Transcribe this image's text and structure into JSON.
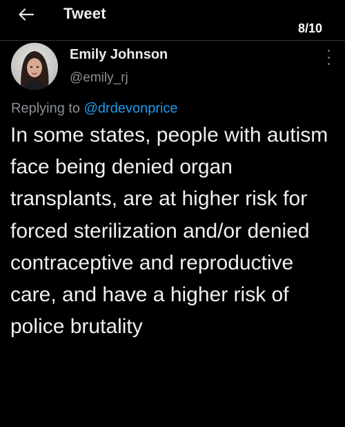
{
  "header": {
    "back_icon": "arrow-left-icon",
    "title": "Tweet",
    "thread_count": "8/10"
  },
  "tweet": {
    "author": {
      "display_name": "Emily Johnson",
      "username": "@emily_rj"
    },
    "more_icon": "more-vertical-icon",
    "replying_prefix": "Replying to ",
    "replying_to": "@drdevonprice",
    "text": "In some states, people with autism face being denied organ transplants, are at higher risk for forced sterilization and/or denied contraceptive and reproductive care, and have a higher risk of police brutality"
  },
  "colors": {
    "background": "#000000",
    "text": "#e7e9ea",
    "secondary_text": "#8b9095",
    "accent": "#1d9bf0",
    "divider": "#2f3336"
  }
}
